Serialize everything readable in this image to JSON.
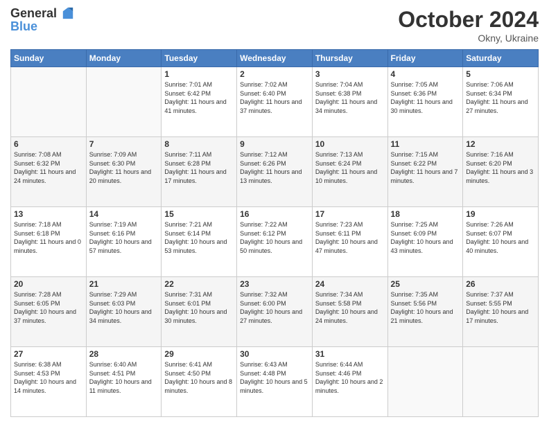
{
  "header": {
    "logo_general": "General",
    "logo_blue": "Blue",
    "month": "October 2024",
    "location": "Okny, Ukraine"
  },
  "days_of_week": [
    "Sunday",
    "Monday",
    "Tuesday",
    "Wednesday",
    "Thursday",
    "Friday",
    "Saturday"
  ],
  "weeks": [
    [
      {
        "day": "",
        "empty": true
      },
      {
        "day": "",
        "empty": true
      },
      {
        "day": "1",
        "sunrise": "Sunrise: 7:01 AM",
        "sunset": "Sunset: 6:42 PM",
        "daylight": "Daylight: 11 hours and 41 minutes."
      },
      {
        "day": "2",
        "sunrise": "Sunrise: 7:02 AM",
        "sunset": "Sunset: 6:40 PM",
        "daylight": "Daylight: 11 hours and 37 minutes."
      },
      {
        "day": "3",
        "sunrise": "Sunrise: 7:04 AM",
        "sunset": "Sunset: 6:38 PM",
        "daylight": "Daylight: 11 hours and 34 minutes."
      },
      {
        "day": "4",
        "sunrise": "Sunrise: 7:05 AM",
        "sunset": "Sunset: 6:36 PM",
        "daylight": "Daylight: 11 hours and 30 minutes."
      },
      {
        "day": "5",
        "sunrise": "Sunrise: 7:06 AM",
        "sunset": "Sunset: 6:34 PM",
        "daylight": "Daylight: 11 hours and 27 minutes."
      }
    ],
    [
      {
        "day": "6",
        "sunrise": "Sunrise: 7:08 AM",
        "sunset": "Sunset: 6:32 PM",
        "daylight": "Daylight: 11 hours and 24 minutes."
      },
      {
        "day": "7",
        "sunrise": "Sunrise: 7:09 AM",
        "sunset": "Sunset: 6:30 PM",
        "daylight": "Daylight: 11 hours and 20 minutes."
      },
      {
        "day": "8",
        "sunrise": "Sunrise: 7:11 AM",
        "sunset": "Sunset: 6:28 PM",
        "daylight": "Daylight: 11 hours and 17 minutes."
      },
      {
        "day": "9",
        "sunrise": "Sunrise: 7:12 AM",
        "sunset": "Sunset: 6:26 PM",
        "daylight": "Daylight: 11 hours and 13 minutes."
      },
      {
        "day": "10",
        "sunrise": "Sunrise: 7:13 AM",
        "sunset": "Sunset: 6:24 PM",
        "daylight": "Daylight: 11 hours and 10 minutes."
      },
      {
        "day": "11",
        "sunrise": "Sunrise: 7:15 AM",
        "sunset": "Sunset: 6:22 PM",
        "daylight": "Daylight: 11 hours and 7 minutes."
      },
      {
        "day": "12",
        "sunrise": "Sunrise: 7:16 AM",
        "sunset": "Sunset: 6:20 PM",
        "daylight": "Daylight: 11 hours and 3 minutes."
      }
    ],
    [
      {
        "day": "13",
        "sunrise": "Sunrise: 7:18 AM",
        "sunset": "Sunset: 6:18 PM",
        "daylight": "Daylight: 11 hours and 0 minutes."
      },
      {
        "day": "14",
        "sunrise": "Sunrise: 7:19 AM",
        "sunset": "Sunset: 6:16 PM",
        "daylight": "Daylight: 10 hours and 57 minutes."
      },
      {
        "day": "15",
        "sunrise": "Sunrise: 7:21 AM",
        "sunset": "Sunset: 6:14 PM",
        "daylight": "Daylight: 10 hours and 53 minutes."
      },
      {
        "day": "16",
        "sunrise": "Sunrise: 7:22 AM",
        "sunset": "Sunset: 6:12 PM",
        "daylight": "Daylight: 10 hours and 50 minutes."
      },
      {
        "day": "17",
        "sunrise": "Sunrise: 7:23 AM",
        "sunset": "Sunset: 6:11 PM",
        "daylight": "Daylight: 10 hours and 47 minutes."
      },
      {
        "day": "18",
        "sunrise": "Sunrise: 7:25 AM",
        "sunset": "Sunset: 6:09 PM",
        "daylight": "Daylight: 10 hours and 43 minutes."
      },
      {
        "day": "19",
        "sunrise": "Sunrise: 7:26 AM",
        "sunset": "Sunset: 6:07 PM",
        "daylight": "Daylight: 10 hours and 40 minutes."
      }
    ],
    [
      {
        "day": "20",
        "sunrise": "Sunrise: 7:28 AM",
        "sunset": "Sunset: 6:05 PM",
        "daylight": "Daylight: 10 hours and 37 minutes."
      },
      {
        "day": "21",
        "sunrise": "Sunrise: 7:29 AM",
        "sunset": "Sunset: 6:03 PM",
        "daylight": "Daylight: 10 hours and 34 minutes."
      },
      {
        "day": "22",
        "sunrise": "Sunrise: 7:31 AM",
        "sunset": "Sunset: 6:01 PM",
        "daylight": "Daylight: 10 hours and 30 minutes."
      },
      {
        "day": "23",
        "sunrise": "Sunrise: 7:32 AM",
        "sunset": "Sunset: 6:00 PM",
        "daylight": "Daylight: 10 hours and 27 minutes."
      },
      {
        "day": "24",
        "sunrise": "Sunrise: 7:34 AM",
        "sunset": "Sunset: 5:58 PM",
        "daylight": "Daylight: 10 hours and 24 minutes."
      },
      {
        "day": "25",
        "sunrise": "Sunrise: 7:35 AM",
        "sunset": "Sunset: 5:56 PM",
        "daylight": "Daylight: 10 hours and 21 minutes."
      },
      {
        "day": "26",
        "sunrise": "Sunrise: 7:37 AM",
        "sunset": "Sunset: 5:55 PM",
        "daylight": "Daylight: 10 hours and 17 minutes."
      }
    ],
    [
      {
        "day": "27",
        "sunrise": "Sunrise: 6:38 AM",
        "sunset": "Sunset: 4:53 PM",
        "daylight": "Daylight: 10 hours and 14 minutes."
      },
      {
        "day": "28",
        "sunrise": "Sunrise: 6:40 AM",
        "sunset": "Sunset: 4:51 PM",
        "daylight": "Daylight: 10 hours and 11 minutes."
      },
      {
        "day": "29",
        "sunrise": "Sunrise: 6:41 AM",
        "sunset": "Sunset: 4:50 PM",
        "daylight": "Daylight: 10 hours and 8 minutes."
      },
      {
        "day": "30",
        "sunrise": "Sunrise: 6:43 AM",
        "sunset": "Sunset: 4:48 PM",
        "daylight": "Daylight: 10 hours and 5 minutes."
      },
      {
        "day": "31",
        "sunrise": "Sunrise: 6:44 AM",
        "sunset": "Sunset: 4:46 PM",
        "daylight": "Daylight: 10 hours and 2 minutes."
      },
      {
        "day": "",
        "empty": true
      },
      {
        "day": "",
        "empty": true
      }
    ]
  ]
}
